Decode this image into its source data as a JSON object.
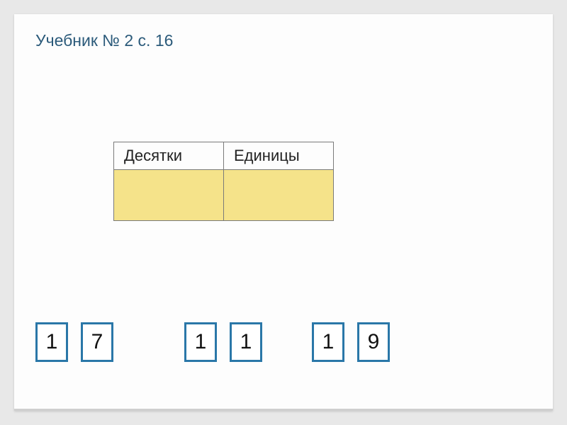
{
  "title": "Учебник № 2 с. 16",
  "table": {
    "headers": [
      "Десятки",
      "Единицы"
    ],
    "rows": [
      [
        "",
        ""
      ]
    ]
  },
  "tiles": {
    "pairs": [
      [
        "1",
        "7"
      ],
      [
        "1",
        "1"
      ],
      [
        "1",
        "9"
      ]
    ]
  },
  "colors": {
    "title": "#2b5a7a",
    "tileBorder": "#2a77a8",
    "cellFill": "#f5e38a"
  }
}
